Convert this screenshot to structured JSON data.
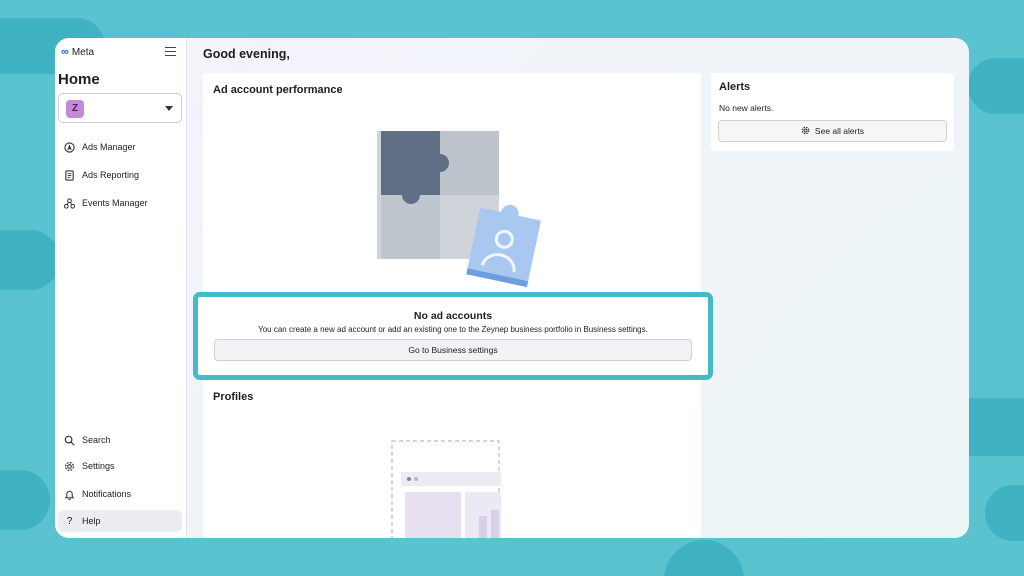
{
  "sidebar": {
    "brand": "Meta",
    "page_title": "Home",
    "account_avatar_letter": "Z",
    "nav_top": [
      {
        "label": "Ads Manager",
        "icon": "navigation-arrow-icon"
      },
      {
        "label": "Ads Reporting",
        "icon": "report-icon"
      },
      {
        "label": "Events Manager",
        "icon": "events-icon"
      }
    ],
    "nav_bottom": [
      {
        "label": "Search",
        "icon": "search-icon"
      },
      {
        "label": "Settings",
        "icon": "gear-icon"
      },
      {
        "label": "Notifications",
        "icon": "bell-icon"
      },
      {
        "label": "Help",
        "icon": "help-icon"
      }
    ]
  },
  "main": {
    "greeting": "Good evening,",
    "ad_performance": {
      "title": "Ad account performance",
      "empty_title": "No ad accounts",
      "empty_description": "You can create a new ad account or add an existing one to the Zeynep business portfolio in Business settings.",
      "button_label": "Go to Business settings"
    },
    "profiles": {
      "title": "Profiles"
    },
    "alerts": {
      "title": "Alerts",
      "empty_text": "No new alerts.",
      "button_label": "See all alerts"
    }
  },
  "colors": {
    "background": "#5bc3cf",
    "highlight": "#46b9c6",
    "avatar": "#c48ad8",
    "meta_blue": "#0866ff"
  }
}
